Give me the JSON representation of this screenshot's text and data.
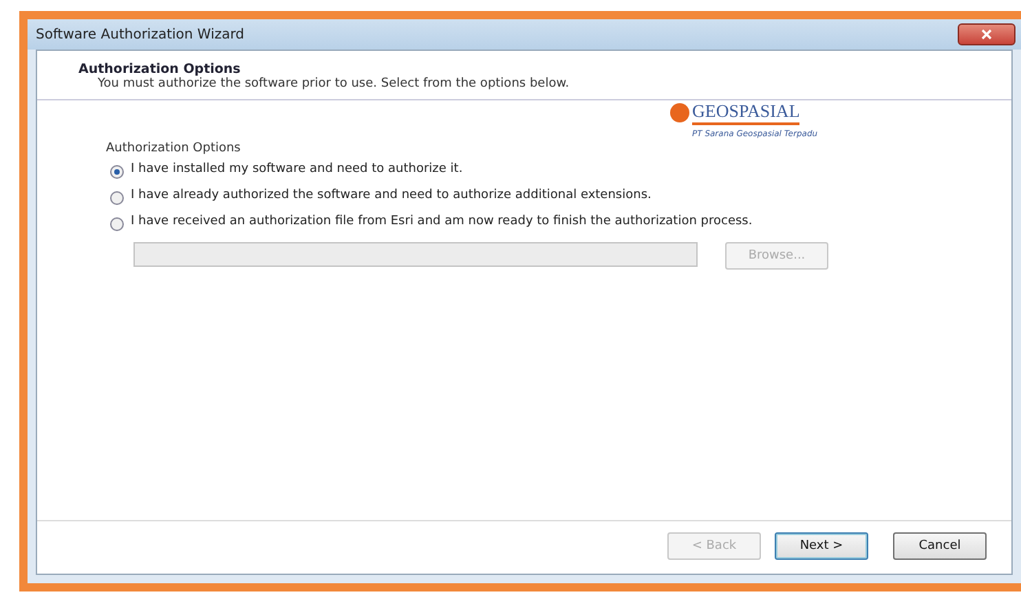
{
  "window": {
    "title": "Software Authorization Wizard"
  },
  "header": {
    "title": "Authorization Options",
    "subtitle": "You must authorize the software prior to use. Select from the options below."
  },
  "logo": {
    "name": "GEOSPASIAL",
    "tagline": "PT Sarana Geospasial Terpadu"
  },
  "group": {
    "label": "Authorization Options"
  },
  "options": [
    {
      "label": "I have installed my software and need to authorize it.",
      "selected": true
    },
    {
      "label": "I have already authorized the software and need to authorize additional extensions.",
      "selected": false
    },
    {
      "label": "I have received an authorization file from Esri and am now ready to finish the authorization process.",
      "selected": false
    }
  ],
  "file_field": {
    "disabled": true
  },
  "browse_button": {
    "label": "Browse...",
    "disabled": true
  },
  "buttons": [
    {
      "label": "< Back",
      "disabled": true
    },
    {
      "label": "Next >",
      "disabled": false
    },
    {
      "label": "Cancel",
      "disabled": false
    }
  ]
}
